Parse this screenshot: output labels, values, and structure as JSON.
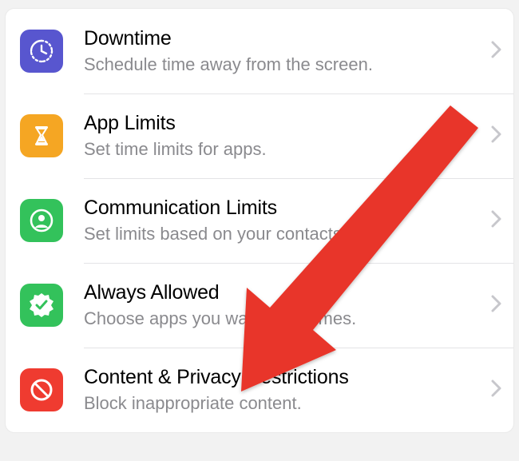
{
  "items": [
    {
      "title": "Downtime",
      "subtitle": "Schedule time away from the screen."
    },
    {
      "title": "App Limits",
      "subtitle": "Set time limits for apps."
    },
    {
      "title": "Communication Limits",
      "subtitle": "Set limits based on your contacts."
    },
    {
      "title": "Always Allowed",
      "subtitle": "Choose apps you want at all times."
    },
    {
      "title": "Content & Privacy Restrictions",
      "subtitle": "Block inappropriate content."
    }
  ]
}
